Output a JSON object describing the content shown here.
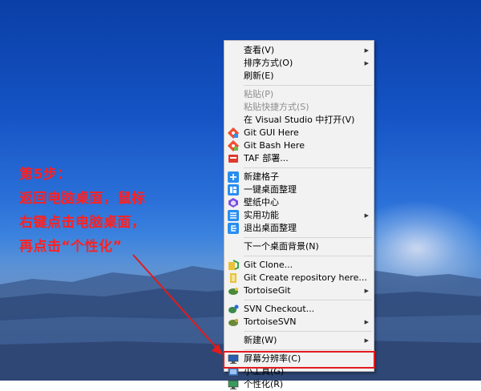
{
  "annotation": {
    "step": "第5步：",
    "line1": "返回电脑桌面，鼠标",
    "line2": "右键点击电脑桌面，",
    "line3": "再点击“个性化”"
  },
  "menu": {
    "view": "查看(V)",
    "sort": "排序方式(O)",
    "refresh": "刷新(E)",
    "paste": "粘贴(P)",
    "paste_shortcut": "粘贴快捷方式(S)",
    "open_vs": "在 Visual Studio 中打开(V)",
    "git_gui": "Git GUI Here",
    "git_bash": "Git Bash Here",
    "taf": "TAF 部署...",
    "new_grid": "新建格子",
    "organize": "一键桌面整理",
    "wallpaper": "壁纸中心",
    "utilities": "实用功能",
    "exit_organize": "退出桌面整理",
    "next_bg": "下一个桌面背景(N)",
    "git_clone": "Git Clone...",
    "git_create": "Git Create repository here...",
    "tortoisegit": "TortoiseGit",
    "svn_checkout": "SVN Checkout...",
    "tortoisesvn": "TortoiseSVN",
    "new": "新建(W)",
    "resolution": "屏幕分辨率(C)",
    "gadgets": "小工具(G)",
    "personalize": "个性化(R)"
  },
  "colors": {
    "annotation": "#ff2020",
    "highlight": "#e21b1b",
    "menu_bg": "#f2f2f2"
  }
}
